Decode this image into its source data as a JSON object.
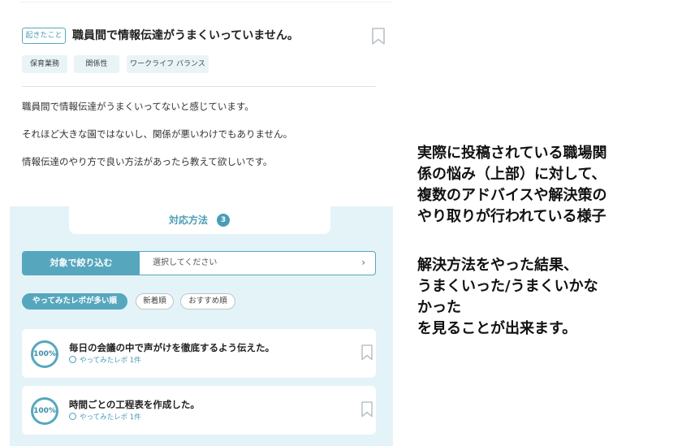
{
  "post": {
    "tag": "起きたこと",
    "title": "職員間で情報伝達がうまくいっていません。",
    "chips": [
      "保育業務",
      "関係性",
      "ワークライフ バランス"
    ],
    "body": [
      "職員間で情報伝達がうまくいってないと感じています。",
      "それほど大きな園ではないし、関係が悪いわけでもありません。",
      "情報伝達のやり方で良い方法があったら教えて欲しいです。"
    ]
  },
  "answers": {
    "tab_label": "対応方法",
    "count": "3",
    "filter_button": "対象で絞り込む",
    "filter_placeholder": "選択してください",
    "filter_chevron": "›",
    "sort": [
      "やってみたレポが多い順",
      "新着順",
      "おすすめ順"
    ],
    "cards": [
      {
        "badge": "100%",
        "title": "毎日の会議の中で声がけを徹底するよう伝えた。",
        "meta": "やってみたレポ 1件"
      },
      {
        "badge": "100%",
        "title": "時間ごとの工程表を作成した。",
        "meta": "やってみたレポ 1件"
      }
    ]
  },
  "annotation": {
    "lines": [
      "実際に投稿されている職場関",
      "係の悩み（上部）に対して、",
      "複数のアドバイスや解決策の",
      "やり取りが行われている様子",
      "",
      "解決方法をやった結果、",
      "うまくいった/うまくいかな",
      "かった",
      "を見ることが出来ます。"
    ]
  },
  "colors": {
    "accent": "#56a7be",
    "accent_dark": "#4a9db5",
    "answer_bg": "#e4f3f7",
    "chip_bg": "#e9f4f7"
  },
  "icons": {
    "bookmark": "bookmark-icon",
    "chat": "chat-bubble-icon",
    "chevron": "chevron-right-icon"
  }
}
